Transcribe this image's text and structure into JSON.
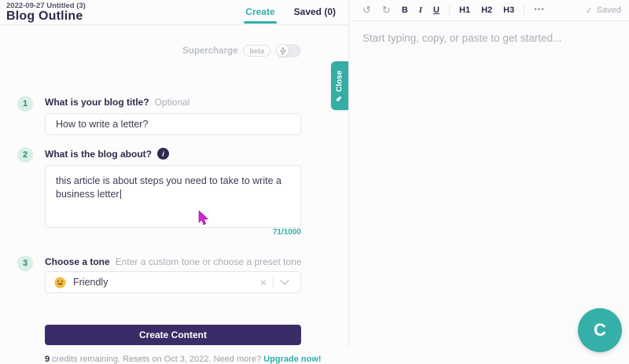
{
  "header": {
    "doc_label": "2022-09-27 Untitled (3)",
    "title": "Blog Outline",
    "tabs": [
      {
        "label": "Create"
      },
      {
        "label": "Saved (0)"
      }
    ]
  },
  "supercharge": {
    "label": "Supercharge",
    "badge": "beta"
  },
  "steps": [
    {
      "number": "1",
      "question": "What is your blog title?",
      "hint": "Optional",
      "value": "How to write a letter?"
    },
    {
      "number": "2",
      "question": "What is the blog about?",
      "value": "this article is about steps you need to take to write a business letter",
      "counter": "71/1000"
    },
    {
      "number": "3",
      "question": "Choose a tone",
      "hint": "Enter a custom tone or choose a preset tone",
      "value": "Friendly"
    }
  ],
  "create_button_label": "Create Content",
  "credits": {
    "count": "9",
    "text": " credits remaining. Resets on Oct 3, 2022. Need more? ",
    "link": "Upgrade now!"
  },
  "editor": {
    "toolbar": {
      "bold": "B",
      "italic": "I",
      "underline": "U",
      "h1": "H1",
      "h2": "H2",
      "h3": "H3"
    },
    "saved_status": "Saved",
    "placeholder": "Start typing, copy, or paste to get started..."
  },
  "close_tab_label": "Close",
  "fab_label": "C",
  "icons": {
    "undo": "↺",
    "redo": "↻",
    "more": "•••",
    "check": "✓",
    "pencil": "✎",
    "clear": "×",
    "info": "i"
  },
  "colors": {
    "accent_teal": "#2fb0a8",
    "button_purple": "#3b2c68",
    "cursor_magenta": "#d127ce"
  }
}
